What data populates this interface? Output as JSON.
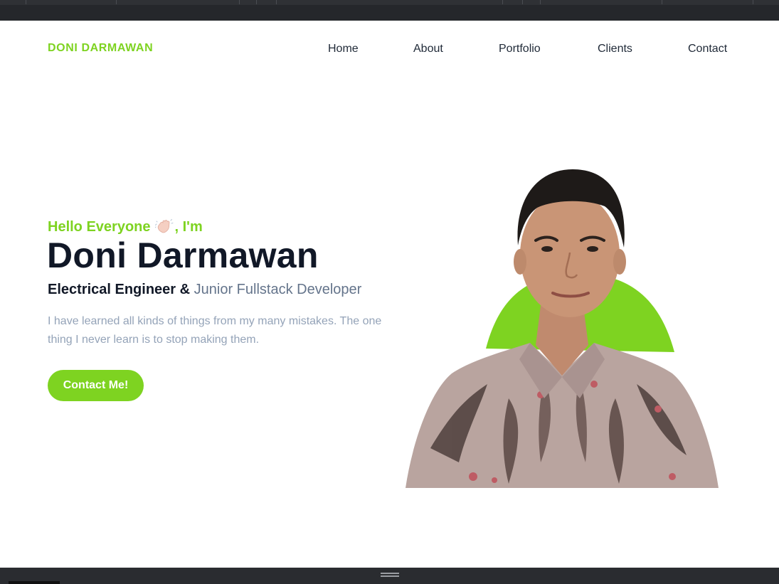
{
  "brand": {
    "name": "DONI DARMAWAN",
    "accent_color": "#7ed321"
  },
  "nav": {
    "items": [
      {
        "label": "Home"
      },
      {
        "label": "About"
      },
      {
        "label": "Portfolio"
      },
      {
        "label": "Clients"
      },
      {
        "label": "Contact"
      }
    ]
  },
  "hero": {
    "greeting_prefix": "Hello Everyone",
    "greeting_suffix": ", I'm",
    "greeting_icon": "waving-hand-icon",
    "name": "Doni Darmawan",
    "role_primary": "Electrical Engineer",
    "role_joiner": " & ",
    "role_secondary": "Junior Fullstack Developer",
    "description": "I have learned all kinds of things from my many mistakes. The one thing I never learn is to stop making them.",
    "cta_label": "Contact Me!",
    "portrait_icon": "profile-photo"
  }
}
